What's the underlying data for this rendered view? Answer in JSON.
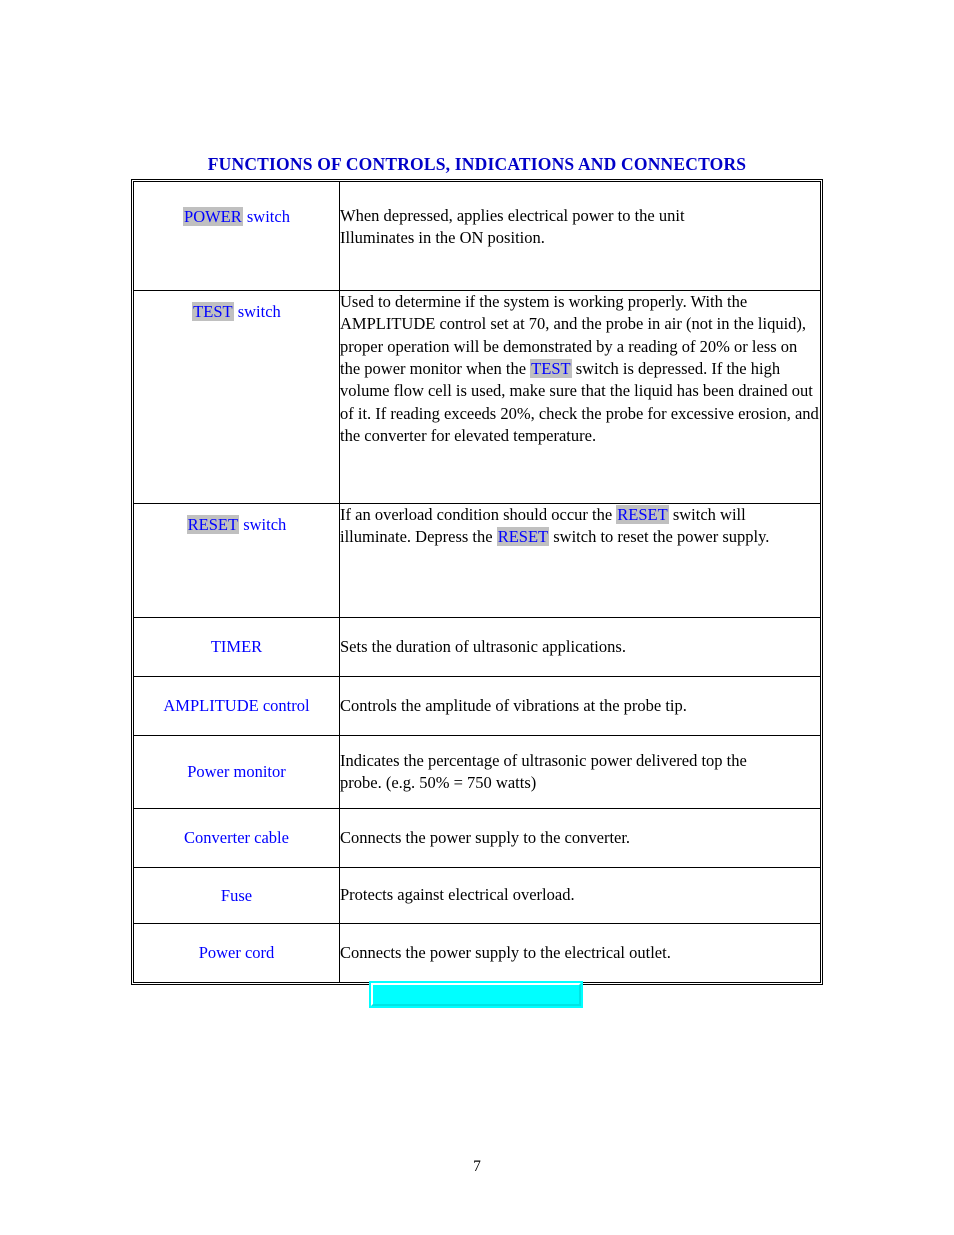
{
  "document": {
    "title": "FUNCTIONS OF CONTROLS, INDICATIONS AND CONNECTORS",
    "page_number": "7",
    "colors": {
      "title_blue": "#0000c8",
      "label_blue": "#0000ff",
      "highlight_gray": "#c0c0c0",
      "cyan_box": "#00ffff",
      "body_text": "#000000"
    }
  },
  "table": {
    "rows": [
      {
        "label_keyword": "POWER",
        "label_suffix": " switch",
        "label_highlighted": true,
        "description_lines": [
          "When depressed, applies electrical power to the unit",
          "Illuminates in the ON position."
        ],
        "description_plain": "When depressed, applies electrical power to the unit Illuminates in the ON position."
      },
      {
        "label_keyword": "TEST",
        "label_suffix": " switch",
        "label_highlighted": true,
        "description_segments": [
          {
            "text": "Used to determine if the system is working properly. With the AMPLITUDE control set at 70, and the probe in air (not in the liquid), proper operation will be demonstrated by a reading of 20% or less on the power monitor when the ",
            "style": "plain"
          },
          {
            "text": "TEST",
            "style": "highlight"
          },
          {
            "text": " switch is depressed. If the high volume flow cell is used, make sure that the liquid has been drained out of it. If reading exceeds 20%, check the probe for excessive erosion, and the converter for elevated temperature.",
            "style": "plain"
          }
        ],
        "description_plain": "Used to determine if the system is working properly. With the AMPLITUDE control set at 70, and the probe in air (not in the liquid), proper operation will be demonstrated by a reading of 20% or less on the power monitor when the TEST switch is depressed. If the high volume flow cell is used, make sure that the liquid has been drained out of it. If reading exceeds 20%, check the probe for excessive erosion, and the converter for elevated temperature."
      },
      {
        "label_keyword": "RESET",
        "label_suffix": " switch",
        "label_highlighted": true,
        "description_segments": [
          {
            "text": "If an overload condition should occur the ",
            "style": "plain"
          },
          {
            "text": "RESET",
            "style": "highlight"
          },
          {
            "text": " switch will illuminate. Depress the ",
            "style": "plain"
          },
          {
            "text": "RESET",
            "style": "highlight"
          },
          {
            "text": " switch to reset the power supply.",
            "style": "plain"
          }
        ],
        "description_plain": "If an overload condition should occur the RESET switch will illuminate. Depress the RESET switch to reset the power supply."
      },
      {
        "label_keyword": "TIMER",
        "label_suffix": "",
        "label_highlighted": false,
        "description_plain": "Sets the duration of ultrasonic applications."
      },
      {
        "label_keyword": "AMPLITUDE control",
        "label_suffix": "",
        "label_highlighted": false,
        "description_plain": "Controls the amplitude of vibrations at the probe tip."
      },
      {
        "label_keyword": "Power monitor",
        "label_suffix": "",
        "label_highlighted": false,
        "description_lines": [
          "Indicates the percentage of ultrasonic power delivered top the",
          "probe. (e.g. 50% = 750 watts)"
        ],
        "description_plain": "Indicates the percentage of ultrasonic power delivered top the probe. (e.g. 50% = 750 watts)"
      },
      {
        "label_keyword": "Converter cable",
        "label_suffix": "",
        "label_highlighted": false,
        "description_plain": "Connects the power supply to the converter."
      },
      {
        "label_keyword": "Fuse",
        "label_suffix": "",
        "label_highlighted": false,
        "description_plain": "Protects against electrical overload."
      },
      {
        "label_keyword": "Power cord",
        "label_suffix": "",
        "label_highlighted": false,
        "description_plain": "Connects the power supply to the electrical outlet."
      }
    ]
  },
  "cyan_placeholder": {
    "label": "",
    "fill": "#00ffff"
  }
}
